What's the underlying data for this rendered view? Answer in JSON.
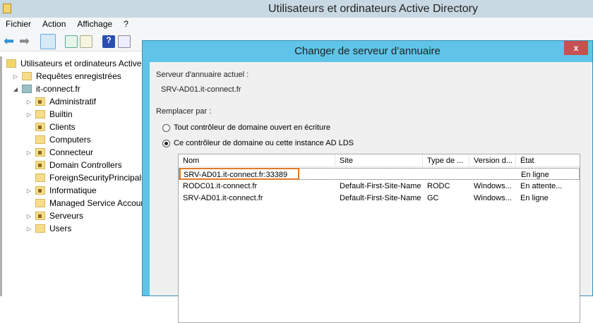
{
  "window": {
    "title": "Utilisateurs et ordinateurs Active Directory"
  },
  "menu": [
    "Fichier",
    "Action",
    "Affichage",
    "?"
  ],
  "tree": {
    "root": "Utilisateurs et ordinateurs Active",
    "items": [
      {
        "label": "Requêtes enregistrées",
        "level": 1,
        "expandable": true,
        "type": "folder"
      },
      {
        "label": "it-connect.fr",
        "level": 1,
        "expanded": true,
        "type": "domain"
      },
      {
        "label": "Administratif",
        "level": 2,
        "expandable": true,
        "type": "ou"
      },
      {
        "label": "Builtin",
        "level": 2,
        "expandable": true,
        "type": "folder"
      },
      {
        "label": "Clients",
        "level": 2,
        "type": "ou"
      },
      {
        "label": "Computers",
        "level": 2,
        "type": "folder"
      },
      {
        "label": "Connecteur",
        "level": 2,
        "expandable": true,
        "type": "ou"
      },
      {
        "label": "Domain Controllers",
        "level": 2,
        "type": "ou"
      },
      {
        "label": "ForeignSecurityPrincipals",
        "level": 2,
        "type": "folder"
      },
      {
        "label": "Informatique",
        "level": 2,
        "expandable": true,
        "type": "ou"
      },
      {
        "label": "Managed Service Accoun",
        "level": 2,
        "type": "folder"
      },
      {
        "label": "Serveurs",
        "level": 2,
        "expandable": true,
        "type": "ou"
      },
      {
        "label": "Users",
        "level": 2,
        "expandable": true,
        "type": "folder"
      }
    ]
  },
  "dialog": {
    "title": "Changer de serveur d’annuaire",
    "close": "x",
    "current_label": "Serveur d'annuaire actuel :",
    "current_value": "SRV-AD01.it-connect.fr",
    "replace_label": "Remplacer par :",
    "option1": "Tout contrôleur de domaine ouvert en écriture",
    "option2": "Ce contrôleur de domaine ou cette instance AD LDS",
    "selected_option": 2,
    "columns": [
      "Nom",
      "Site",
      "Type de ...",
      "Version d...",
      "État"
    ],
    "rows": [
      [
        "SRV-AD01.it-connect.fr:33389",
        "",
        "",
        "",
        "En ligne"
      ],
      [
        "RODC01.it-connect.fr",
        "Default-First-Site-Name",
        "RODC",
        "Windows...",
        "En attente..."
      ],
      [
        "SRV-AD01.it-connect.fr",
        "Default-First-Site-Name",
        "GC",
        "Windows...",
        "En ligne"
      ]
    ],
    "highlight_color": "#e07b2a"
  }
}
